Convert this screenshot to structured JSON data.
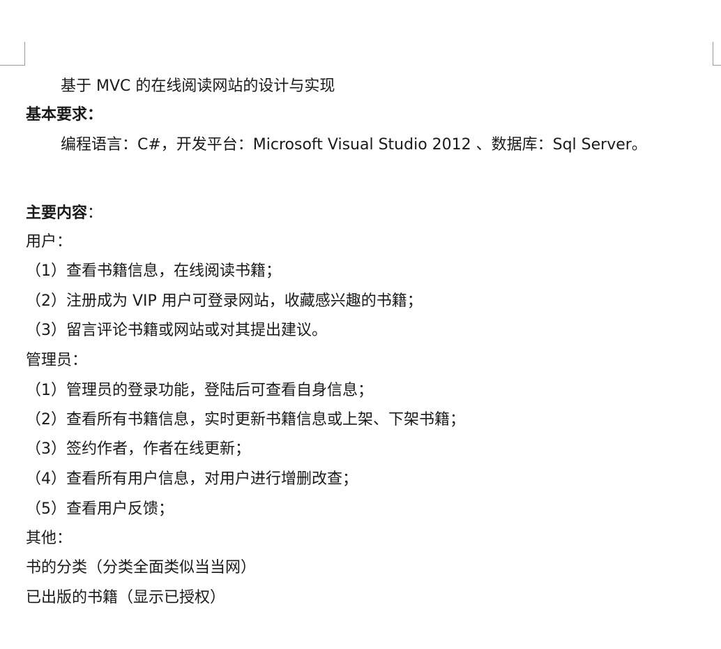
{
  "document": {
    "title": "基于 MVC 的在线阅读网站的设计与实现",
    "requirements_heading": "基本要求：",
    "requirements_text": "编程语言：C#，开发平台：Microsoft Visual Studio 2012 、数据库：Sql Server。",
    "main_heading_bold": "主要内容",
    "main_heading_colon": "：",
    "user_heading": "用户：",
    "user_items": [
      "（1）查看书籍信息，在线阅读书籍；",
      "（2）注册成为 VIP 用户可登录网站，收藏感兴趣的书籍；",
      "（3）留言评论书籍或网站或对其提出建议。"
    ],
    "admin_heading": "管理员：",
    "admin_items": [
      "（1）管理员的登录功能，登陆后可查看自身信息；",
      "（2）查看所有书籍信息，实时更新书籍信息或上架、下架书籍；",
      "（3）签约作者，作者在线更新；",
      "（4）查看所有用户信息，对用户进行增删改查；",
      "（5）查看用户反馈；"
    ],
    "other_heading": "其他：",
    "other_items": [
      "书的分类（分类全面类似当当网）",
      "已出版的书籍（显示已授权）"
    ]
  }
}
